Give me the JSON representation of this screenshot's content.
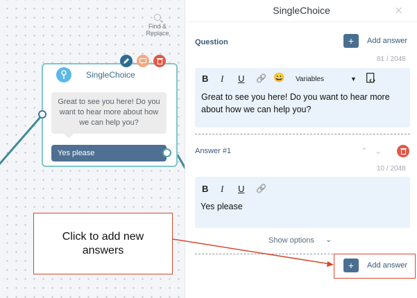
{
  "canvas": {
    "find_replace": "Find & Replace",
    "node": {
      "title": "SingleChoice",
      "message": "Great to see you here! Do you want to hear more about how we can help you?",
      "answer": "Yes please"
    }
  },
  "panel": {
    "title": "SingleChoice",
    "close_icon": "×",
    "question": {
      "label": "Question",
      "add_answer": "Add answer",
      "counter": "81 / 2048",
      "toolbar": {
        "bold": "B",
        "italic": "I",
        "underline": "U",
        "link": "🔗",
        "emoji": "😀",
        "variables": "Variables"
      },
      "text_line1": "Great to see you here! Do you want to hear more",
      "text_line2": "about how we can help you?"
    },
    "answer": {
      "label": "Answer #1",
      "counter": "10 / 2048",
      "toolbar": {
        "bold": "B",
        "italic": "I",
        "underline": "U",
        "link": "🔗"
      },
      "text": "Yes please"
    },
    "show_options": "Show options",
    "add_answer_bottom": "Add answer"
  },
  "annotation": {
    "callout": "Click to add new answers"
  },
  "colors": {
    "accent": "#4a6e8f",
    "node_border": "#7fc6cc",
    "annotation": "#d8472b",
    "delete": "#e05a4a"
  }
}
